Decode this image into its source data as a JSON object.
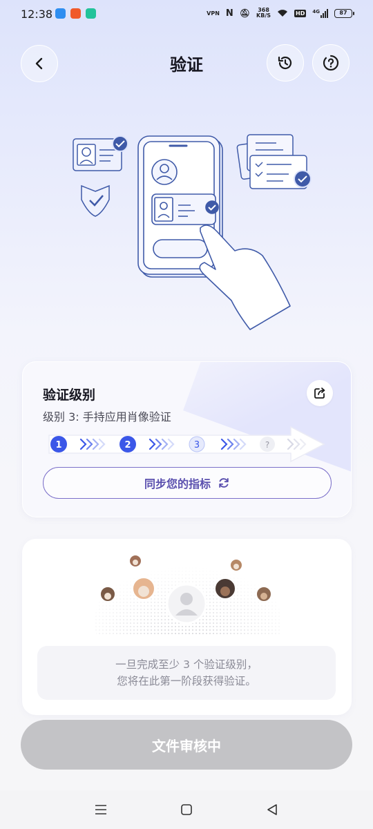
{
  "status_bar": {
    "time": "12:38",
    "network_speed_value": "368",
    "network_speed_unit": "KB/S",
    "hd_label": "HD",
    "network_type": "4G",
    "battery": "87",
    "vpn_label": "VPN"
  },
  "header": {
    "title": "验证",
    "icons": [
      "back-icon",
      "history-icon",
      "help-icon"
    ]
  },
  "level_card": {
    "title": "验证级别",
    "subtitle": "级别 3: 手持应用肖像验证",
    "steps": [
      {
        "label": "1",
        "state": "done"
      },
      {
        "label": "2",
        "state": "done"
      },
      {
        "label": "3",
        "state": "current"
      },
      {
        "label": "?",
        "state": "locked"
      }
    ],
    "sync_button": "同步您的指标"
  },
  "info_card": {
    "message_line1": "一旦完成至少 3 个验证级别，",
    "message_line2": "您将在此第一阶段获得验证。"
  },
  "primary_button": {
    "label": "文件审核中",
    "state": "disabled"
  },
  "colors": {
    "accent": "#3b57e8",
    "sync_border": "#7b6fc9",
    "disabled_button": "#c3c3c6",
    "illustration_line": "#3f5aa8"
  }
}
